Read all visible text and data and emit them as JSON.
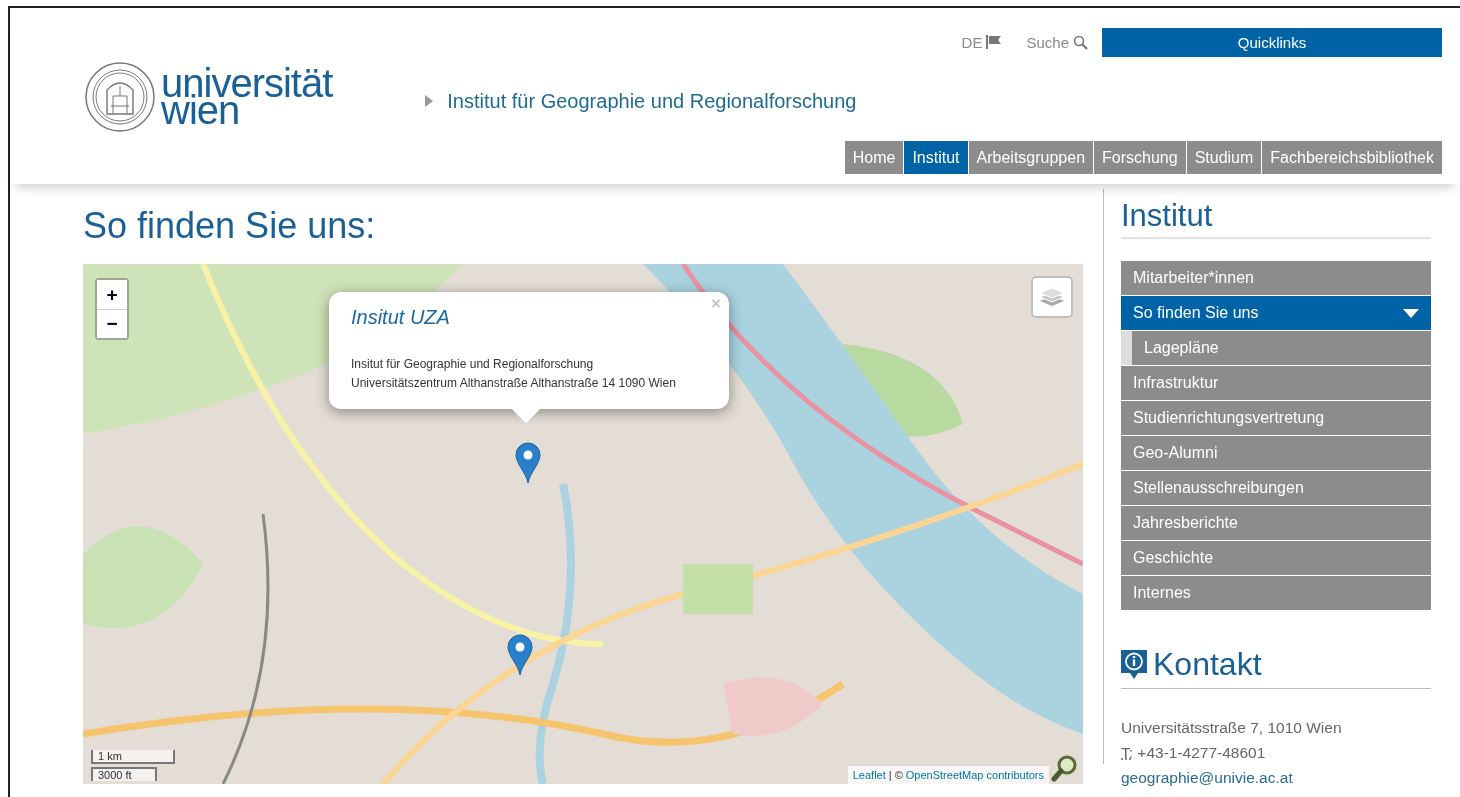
{
  "top_links": {
    "language": "DE",
    "search": "Suche",
    "quicklinks": "Quicklinks"
  },
  "logo": {
    "lines": [
      "universität",
      "wien"
    ]
  },
  "breadcrumb": "Institut für Geographie und Regionalforschung",
  "nav": [
    {
      "label": "Home",
      "selected": false
    },
    {
      "label": "Institut",
      "selected": true
    },
    {
      "label": "Arbeitsgruppen",
      "selected": false
    },
    {
      "label": "Forschung",
      "selected": false
    },
    {
      "label": "Studium",
      "selected": false
    },
    {
      "label": "Fachbereichsbibliothek",
      "selected": false
    }
  ],
  "page_title": "So finden Sie uns:",
  "map": {
    "zoom_in": "+",
    "zoom_out": "−",
    "popup": {
      "title": "Insitut UZA",
      "close": "×",
      "lines": [
        "Insitut für Geographie und Regionalforschung",
        "Universitätszentrum Althanstraße Althanstraße 14 1090 Wien"
      ]
    },
    "scale": [
      "1 km",
      "3000 ft"
    ],
    "attribution": {
      "leaflet": "Leaflet",
      "separator": "| ©",
      "osm": "OpenStreetMap contributors"
    }
  },
  "sidebar": {
    "title": "Institut",
    "items": [
      {
        "label": "Mitarbeiter*innen",
        "selected": false
      },
      {
        "label": "So finden Sie uns",
        "selected": true,
        "expanded": true,
        "children": [
          {
            "label": "Lagepläne",
            "selected": false
          }
        ]
      },
      {
        "label": "Infrastruktur",
        "selected": false
      },
      {
        "label": "Studienrichtungsvertretung",
        "selected": false
      },
      {
        "label": "Geo-Alumni",
        "selected": false
      },
      {
        "label": "Stellenausschreibungen",
        "selected": false
      },
      {
        "label": "Jahresberichte",
        "selected": false
      },
      {
        "label": "Geschichte",
        "selected": false
      },
      {
        "label": "Internes",
        "selected": false
      }
    ]
  },
  "contact": {
    "title": "Kontakt",
    "address": "Universitätsstraße 7, 1010 Wien",
    "phone_label": "T:",
    "phone": "+43-1-4277-48601",
    "email": "geographie@univie.ac.at"
  }
}
